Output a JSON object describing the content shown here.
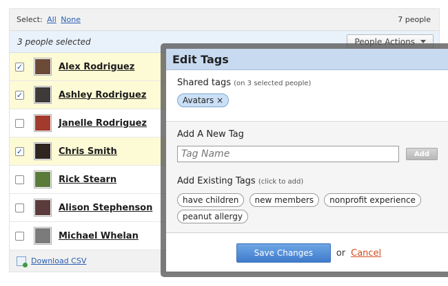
{
  "select_bar": {
    "label": "Select:",
    "all": "All",
    "none": "None",
    "count": "7 people"
  },
  "selected_bar": {
    "text": "3 people selected",
    "actions_label": "People Actions"
  },
  "people": [
    {
      "name": "Alex Rodriguez",
      "checked": true,
      "avatar_color": "#6b4a38"
    },
    {
      "name": "Ashley Rodriguez",
      "checked": true,
      "avatar_color": "#3f3a3a"
    },
    {
      "name": "Janelle Rodriguez",
      "checked": false,
      "avatar_color": "#a23a2e"
    },
    {
      "name": "Chris Smith",
      "checked": true,
      "avatar_color": "#2f261f"
    },
    {
      "name": "Rick Stearn",
      "checked": false,
      "avatar_color": "#5a7b3a"
    },
    {
      "name": "Alison Stephenson",
      "checked": false,
      "avatar_color": "#5b3b3b"
    },
    {
      "name": "Michael Whelan",
      "checked": false,
      "avatar_color": "#7b7b7b"
    }
  ],
  "csv": {
    "label": "Download CSV"
  },
  "modal": {
    "title": "Edit Tags",
    "shared": {
      "title": "Shared tags",
      "hint": "(on 3 selected people)",
      "tags": [
        "Avatars ×"
      ]
    },
    "new_tag": {
      "title": "Add A New Tag",
      "placeholder": "Tag Name",
      "add_label": "Add"
    },
    "existing": {
      "title": "Add Existing Tags",
      "hint": "(click to add)",
      "tags": [
        "have children",
        "new members",
        "nonprofit experience",
        "peanut allergy"
      ]
    },
    "footer": {
      "save_label": "Save Changes",
      "or": "or",
      "cancel_label": "Cancel"
    }
  },
  "colors": {
    "selected_row": "#fdfbd5",
    "accent_blue": "#3f7bcb",
    "header_blue": "#c8daf0",
    "cancel": "#d24c1d"
  }
}
